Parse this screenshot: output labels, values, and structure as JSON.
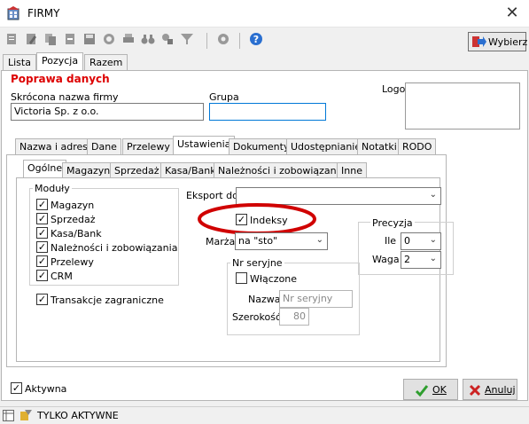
{
  "window": {
    "title": "FIRMY",
    "close": "✕"
  },
  "toolbar": {
    "wybierz_label": "Wybierz"
  },
  "top_tabs": [
    "Lista",
    "Pozycja",
    "Razem"
  ],
  "section_title": "Poprawa danych",
  "form": {
    "short_name_label": "Skrócona nazwa firmy",
    "short_name_value": "Victoria Sp. z o.o.",
    "group_label": "Grupa",
    "group_value": "",
    "logo_label": "Logo"
  },
  "detail_tabs": [
    "Nazwa i adres",
    "Dane",
    "Przelewy",
    "Ustawienia",
    "Dokumenty",
    "Udostępnianie",
    "Notatki",
    "RODO"
  ],
  "settings_tabs": [
    "Ogólne",
    "Magazyn",
    "Sprzedaż",
    "Kasa/Bank",
    "Należności i zobowiązania",
    "Inne"
  ],
  "modules": {
    "title": "Moduły",
    "items": [
      "Magazyn",
      "Sprzedaż",
      "Kasa/Bank",
      "Należności i zobowiązania",
      "Przelewy",
      "CRM"
    ]
  },
  "foreign": {
    "label": "Transakcje zagraniczne"
  },
  "export": {
    "label": "Eksport do",
    "value": ""
  },
  "indeksy": {
    "label": "Indeksy"
  },
  "marza": {
    "label": "Marża",
    "value": "na \"sto\""
  },
  "precyzja": {
    "title": "Precyzja",
    "ile_label": "Ile",
    "ile_value": "0",
    "waga_label": "Waga",
    "waga_value": "2"
  },
  "nr_seryjne": {
    "title": "Nr seryjne",
    "enabled_label": "Włączone",
    "name_label": "Nazwa",
    "name_placeholder": "Nr seryjny",
    "width_label": "Szerokość",
    "width_value": "80"
  },
  "aktywna": {
    "label": "Aktywna"
  },
  "buttons": {
    "ok": "OK",
    "cancel": "Anuluj"
  },
  "status": {
    "text": "TYLKO AKTYWNE"
  },
  "colors": {
    "accent": "#d00000",
    "focus": "#0078d7",
    "ok_green": "#2e9e2e",
    "cancel_red": "#cc2222"
  }
}
